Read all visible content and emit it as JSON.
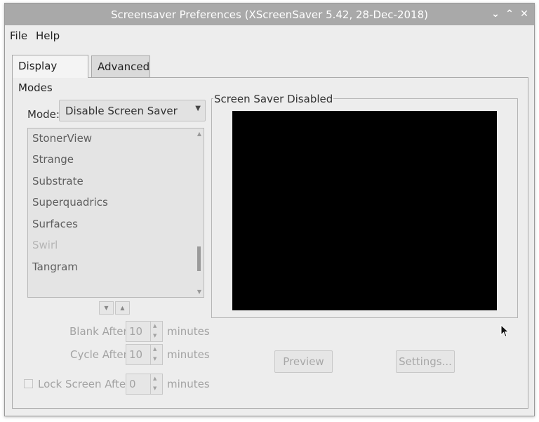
{
  "window": {
    "title": "Screensaver Preferences  (XScreenSaver 5.42, 28-Dec-2018)",
    "controls": {
      "minimize": "⌄",
      "maximize": "⌃",
      "close": "✕"
    }
  },
  "menubar": {
    "file": "File",
    "help": "Help"
  },
  "tabs": {
    "display_modes": "Display Modes",
    "advanced": "Advanced"
  },
  "mode": {
    "label": "Mode:",
    "value": "Disable Screen Saver"
  },
  "hack_list": {
    "items": [
      {
        "label": "StonerView",
        "enabled": true
      },
      {
        "label": "Strange",
        "enabled": true
      },
      {
        "label": "Substrate",
        "enabled": true
      },
      {
        "label": "Superquadrics",
        "enabled": true
      },
      {
        "label": "Surfaces",
        "enabled": true
      },
      {
        "label": "Swirl",
        "enabled": false
      },
      {
        "label": "Tangram",
        "enabled": true
      }
    ]
  },
  "blank_after": {
    "label": "Blank After",
    "value": "10",
    "unit": "minutes"
  },
  "cycle_after": {
    "label": "Cycle After",
    "value": "10",
    "unit": "minutes"
  },
  "lock_screen": {
    "label": "Lock Screen After",
    "value": "0",
    "unit": "minutes",
    "checked": false
  },
  "preview_frame": {
    "label": "Screen Saver Disabled"
  },
  "buttons": {
    "preview": "Preview",
    "settings": "Settings..."
  },
  "icons": {
    "dropdown": "triangle-down-icon",
    "scroll_up": "scroll-up-icon",
    "scroll_down": "scroll-down-icon",
    "cursor": "mouse-pointer-icon"
  }
}
